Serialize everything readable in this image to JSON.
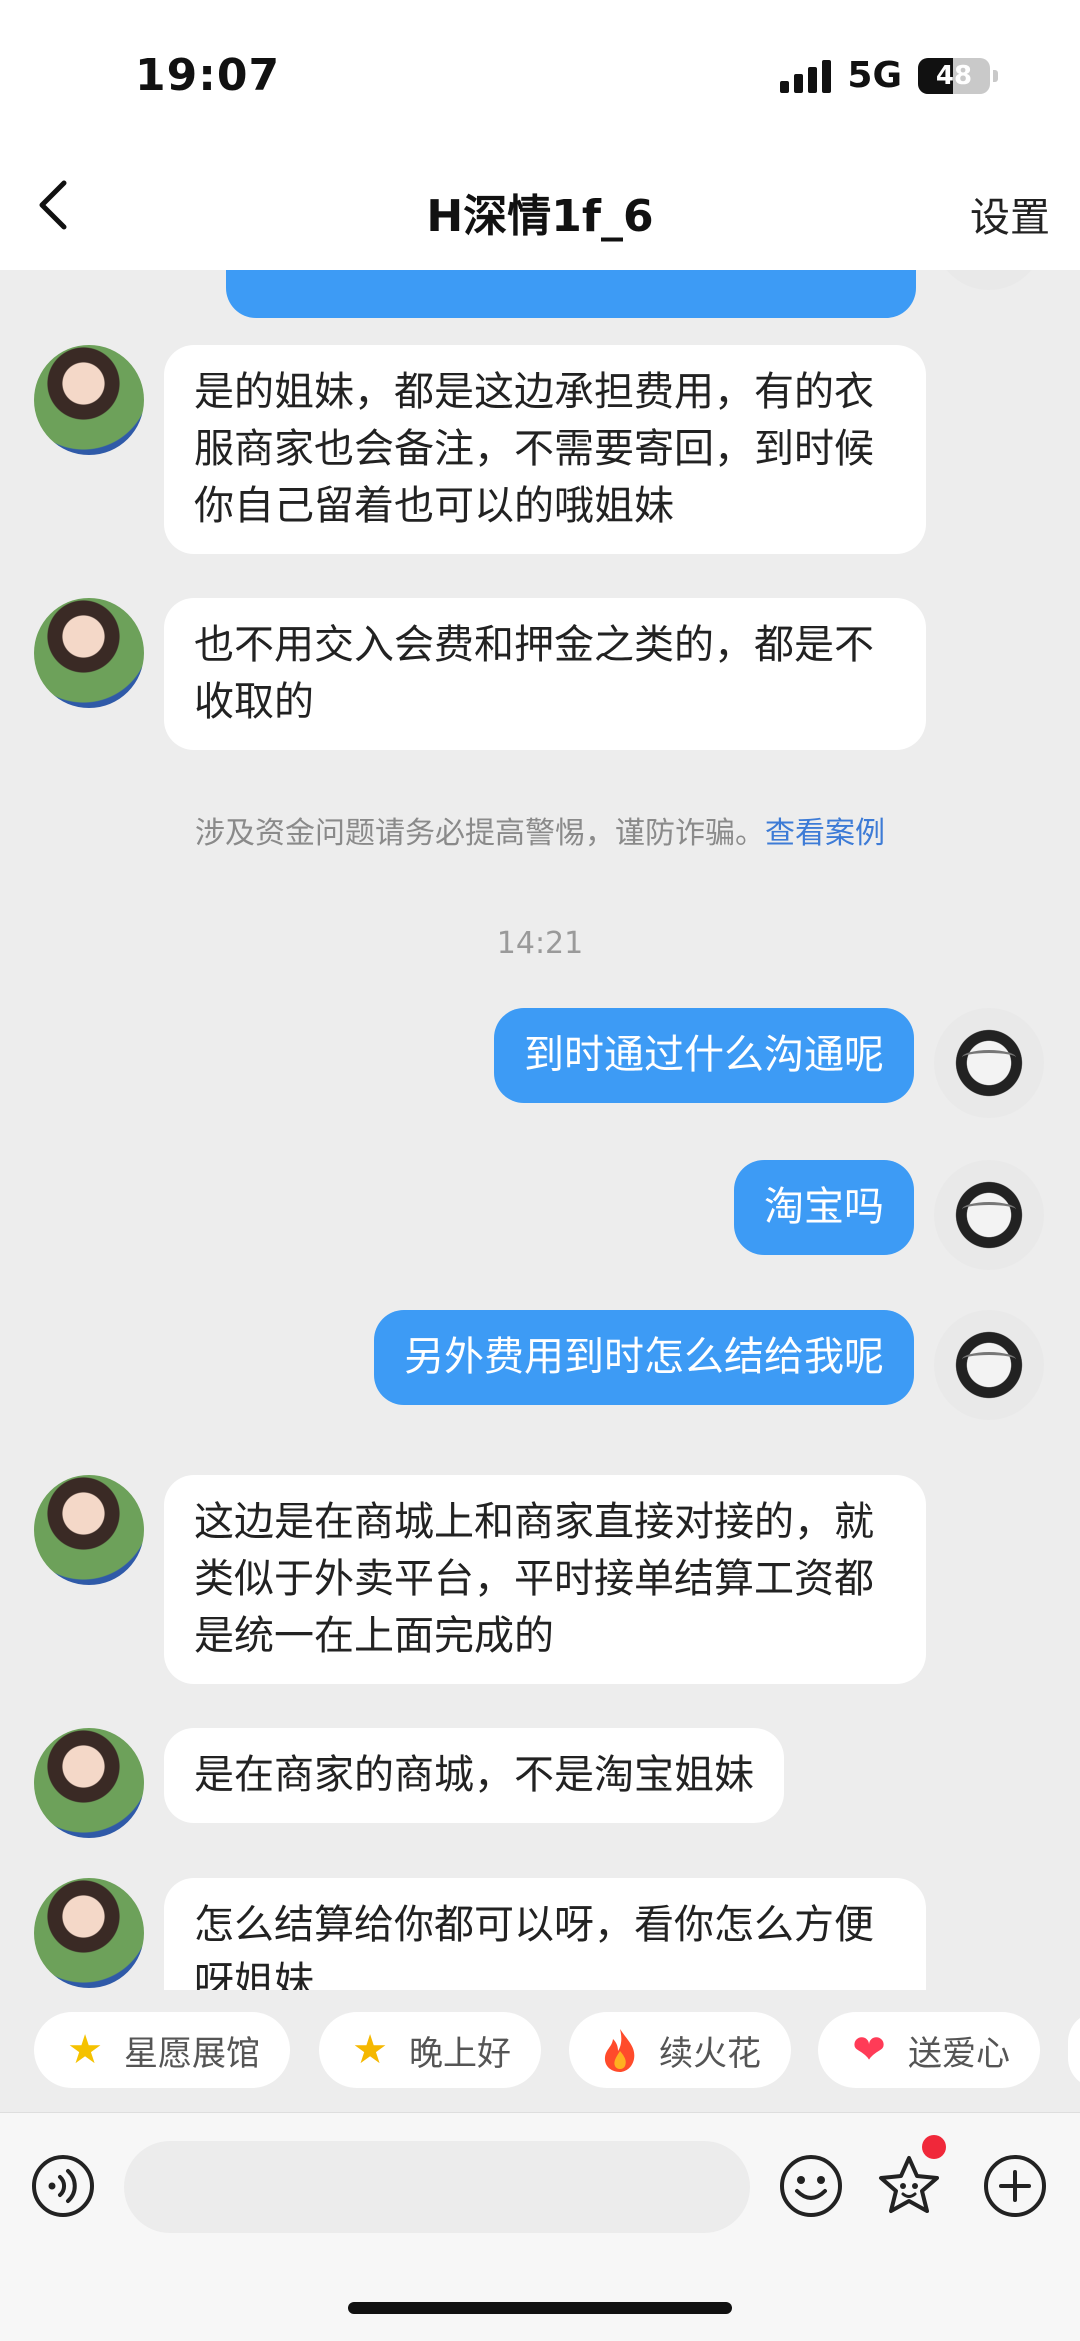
{
  "status_bar": {
    "time": "19:07",
    "network": "5G",
    "battery": "48",
    "battery_level": 0.48
  },
  "header": {
    "title": "H深情1f_6",
    "settings_label": "设置"
  },
  "messages": [
    {
      "side": "in",
      "text": "是的姐妹，都是这边承担费用，有的衣服商家也会备注，不需要寄回，到时候你自己留着也可以的哦姐妹"
    },
    {
      "side": "in",
      "text": "也不用交入会费和押金之类的，都是不收取的"
    },
    {
      "side": "out",
      "text": "到时通过什么沟通呢"
    },
    {
      "side": "out",
      "text": "淘宝吗"
    },
    {
      "side": "out",
      "text": "另外费用到时怎么结给我呢"
    },
    {
      "side": "in",
      "text": "这边是在商城上和商家直接对接的，就类似于外卖平台，平时接单结算工资都是统一在上面完成的"
    },
    {
      "side": "in",
      "text": "是在商家的商城，不是淘宝姐妹"
    },
    {
      "side": "in",
      "text": "怎么结算给你都可以呀，看你怎么方便呀姐妹"
    }
  ],
  "notice": {
    "text": "涉及资金问题请务必提高警惕，谨防诈骗。",
    "link": "查看案例"
  },
  "timestamp": "14:21",
  "quick_chips": [
    {
      "label": "星愿展馆",
      "icon": "star-icon"
    },
    {
      "label": "晚上好",
      "icon": "star-face-icon"
    },
    {
      "label": "续火花",
      "icon": "fire-icon"
    },
    {
      "label": "送爱心",
      "icon": "heart-icon"
    }
  ],
  "input": {
    "placeholder": ""
  },
  "colors": {
    "out_bubble": "#3d9bf5",
    "in_bubble": "#ffffff",
    "background": "#ededed",
    "link": "#3d7bd6"
  }
}
